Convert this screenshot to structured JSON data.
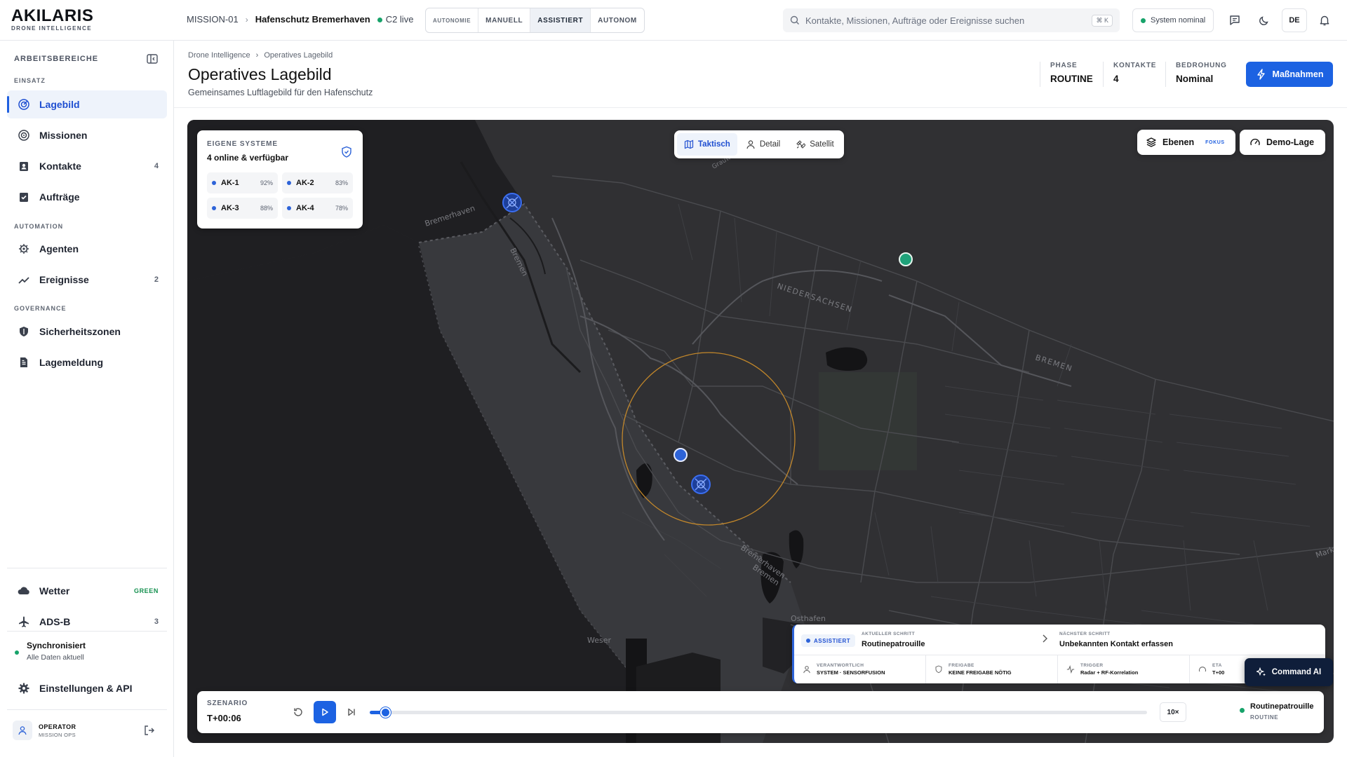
{
  "brand": {
    "name": "AKILARIS",
    "tagline": "DRONE INTELLIGENCE"
  },
  "topbar": {
    "mission": "MISSION-01",
    "location": "Hafenschutz Bremerhaven",
    "link_status": "C2 live",
    "modes": [
      {
        "label": "AUTONOMIE",
        "active": false
      },
      {
        "label": "MANUELL",
        "active": false
      },
      {
        "label": "ASSISTIERT",
        "active": true
      },
      {
        "label": "AUTONOM",
        "active": false
      }
    ],
    "search_placeholder": "Kontakte, Missionen, Aufträge oder Ereignisse suchen",
    "search_shortcut": "⌘ K",
    "system_status": "System nominal",
    "language": "DE"
  },
  "sidebar": {
    "heading": "ARBEITSBEREICHE",
    "sections": [
      {
        "label": "EINSATZ"
      },
      {
        "label": "AUTOMATION"
      },
      {
        "label": "GOVERNANCE"
      }
    ],
    "items": [
      {
        "label": "Lagebild",
        "badge": "",
        "active": true
      },
      {
        "label": "Missionen",
        "badge": ""
      },
      {
        "label": "Kontakte",
        "badge": "4"
      },
      {
        "label": "Aufträge",
        "badge": ""
      },
      {
        "label": "Agenten",
        "badge": ""
      },
      {
        "label": "Ereignisse",
        "badge": "2"
      },
      {
        "label": "Sicherheitszonen",
        "badge": ""
      },
      {
        "label": "Lagemeldung",
        "badge": ""
      }
    ],
    "weather": {
      "label": "Wetter",
      "badge": "GREEN"
    },
    "adsb": {
      "label": "ADS-B",
      "badge": "3"
    },
    "sync": {
      "title": "Synchronisiert",
      "detail": "Alle Daten aktuell"
    },
    "settings": "Einstellungen & API",
    "operator": {
      "role": "OPERATOR",
      "unit": "MISSION OPS"
    }
  },
  "page": {
    "breadcrumb": [
      "Drone Intelligence",
      "Operatives Lagebild"
    ],
    "title": "Operatives Lagebild",
    "subtitle": "Gemeinsames Luftlagebild für den Hafenschutz",
    "stats": [
      {
        "key": "PHASE",
        "value": "ROUTINE"
      },
      {
        "key": "KONTAKTE",
        "value": "4"
      },
      {
        "key": "BEDROHUNG",
        "value": "Nominal"
      }
    ],
    "action": "Maßnahmen"
  },
  "map": {
    "own_systems": {
      "heading": "EIGENE SYSTEME",
      "summary": "4 online & verfügbar",
      "drones": [
        {
          "id": "AK-1",
          "battery": "92%"
        },
        {
          "id": "AK-2",
          "battery": "83%"
        },
        {
          "id": "AK-3",
          "battery": "88%"
        },
        {
          "id": "AK-4",
          "battery": "78%"
        }
      ]
    },
    "views": [
      {
        "label": "Taktisch",
        "active": true
      },
      {
        "label": "Detail",
        "active": false
      },
      {
        "label": "Satellit",
        "active": false
      }
    ],
    "layers": {
      "label": "Ebenen",
      "tag": "FOKUS"
    },
    "demo": "Demo-Lage",
    "labels": {
      "bremerhaven": "Bremerhaven",
      "bremen_road": "Bremen",
      "niedersachsen": "NIEDERSACHSEN",
      "bremen_state": "BREMEN",
      "bremerhaven_lower": "Bremerhaven",
      "bremen_lower": "Bremen",
      "osthafen": "Osthafen",
      "weser": "Weser",
      "grauwall": "Grauwall",
      "mark": "Mark"
    },
    "step": {
      "mode_tag": "ASSISTIERT",
      "current_key": "AKTUELLER SCHRITT",
      "current_value": "Routinepatrouille",
      "next_key": "NÄCHSTER SCHRITT",
      "next_value": "Unbekannten Kontakt erfassen",
      "details": [
        {
          "key": "VERANTWORTLICH",
          "value": "SYSTEM · SENSORFUSION"
        },
        {
          "key": "FREIGABE",
          "value": "KEINE FREIGABE NÖTIG"
        },
        {
          "key": "TRIGGER",
          "value": "Radar + RF-Korrelation"
        },
        {
          "key": "ETA",
          "value": "T+00"
        }
      ]
    },
    "command_ai": "Command AI",
    "scenario": {
      "key": "SZENARIO",
      "time": "T+00:06",
      "progress": 0.02,
      "speed": "10×",
      "status": "Routinepatrouille",
      "phase": "ROUTINE"
    }
  }
}
